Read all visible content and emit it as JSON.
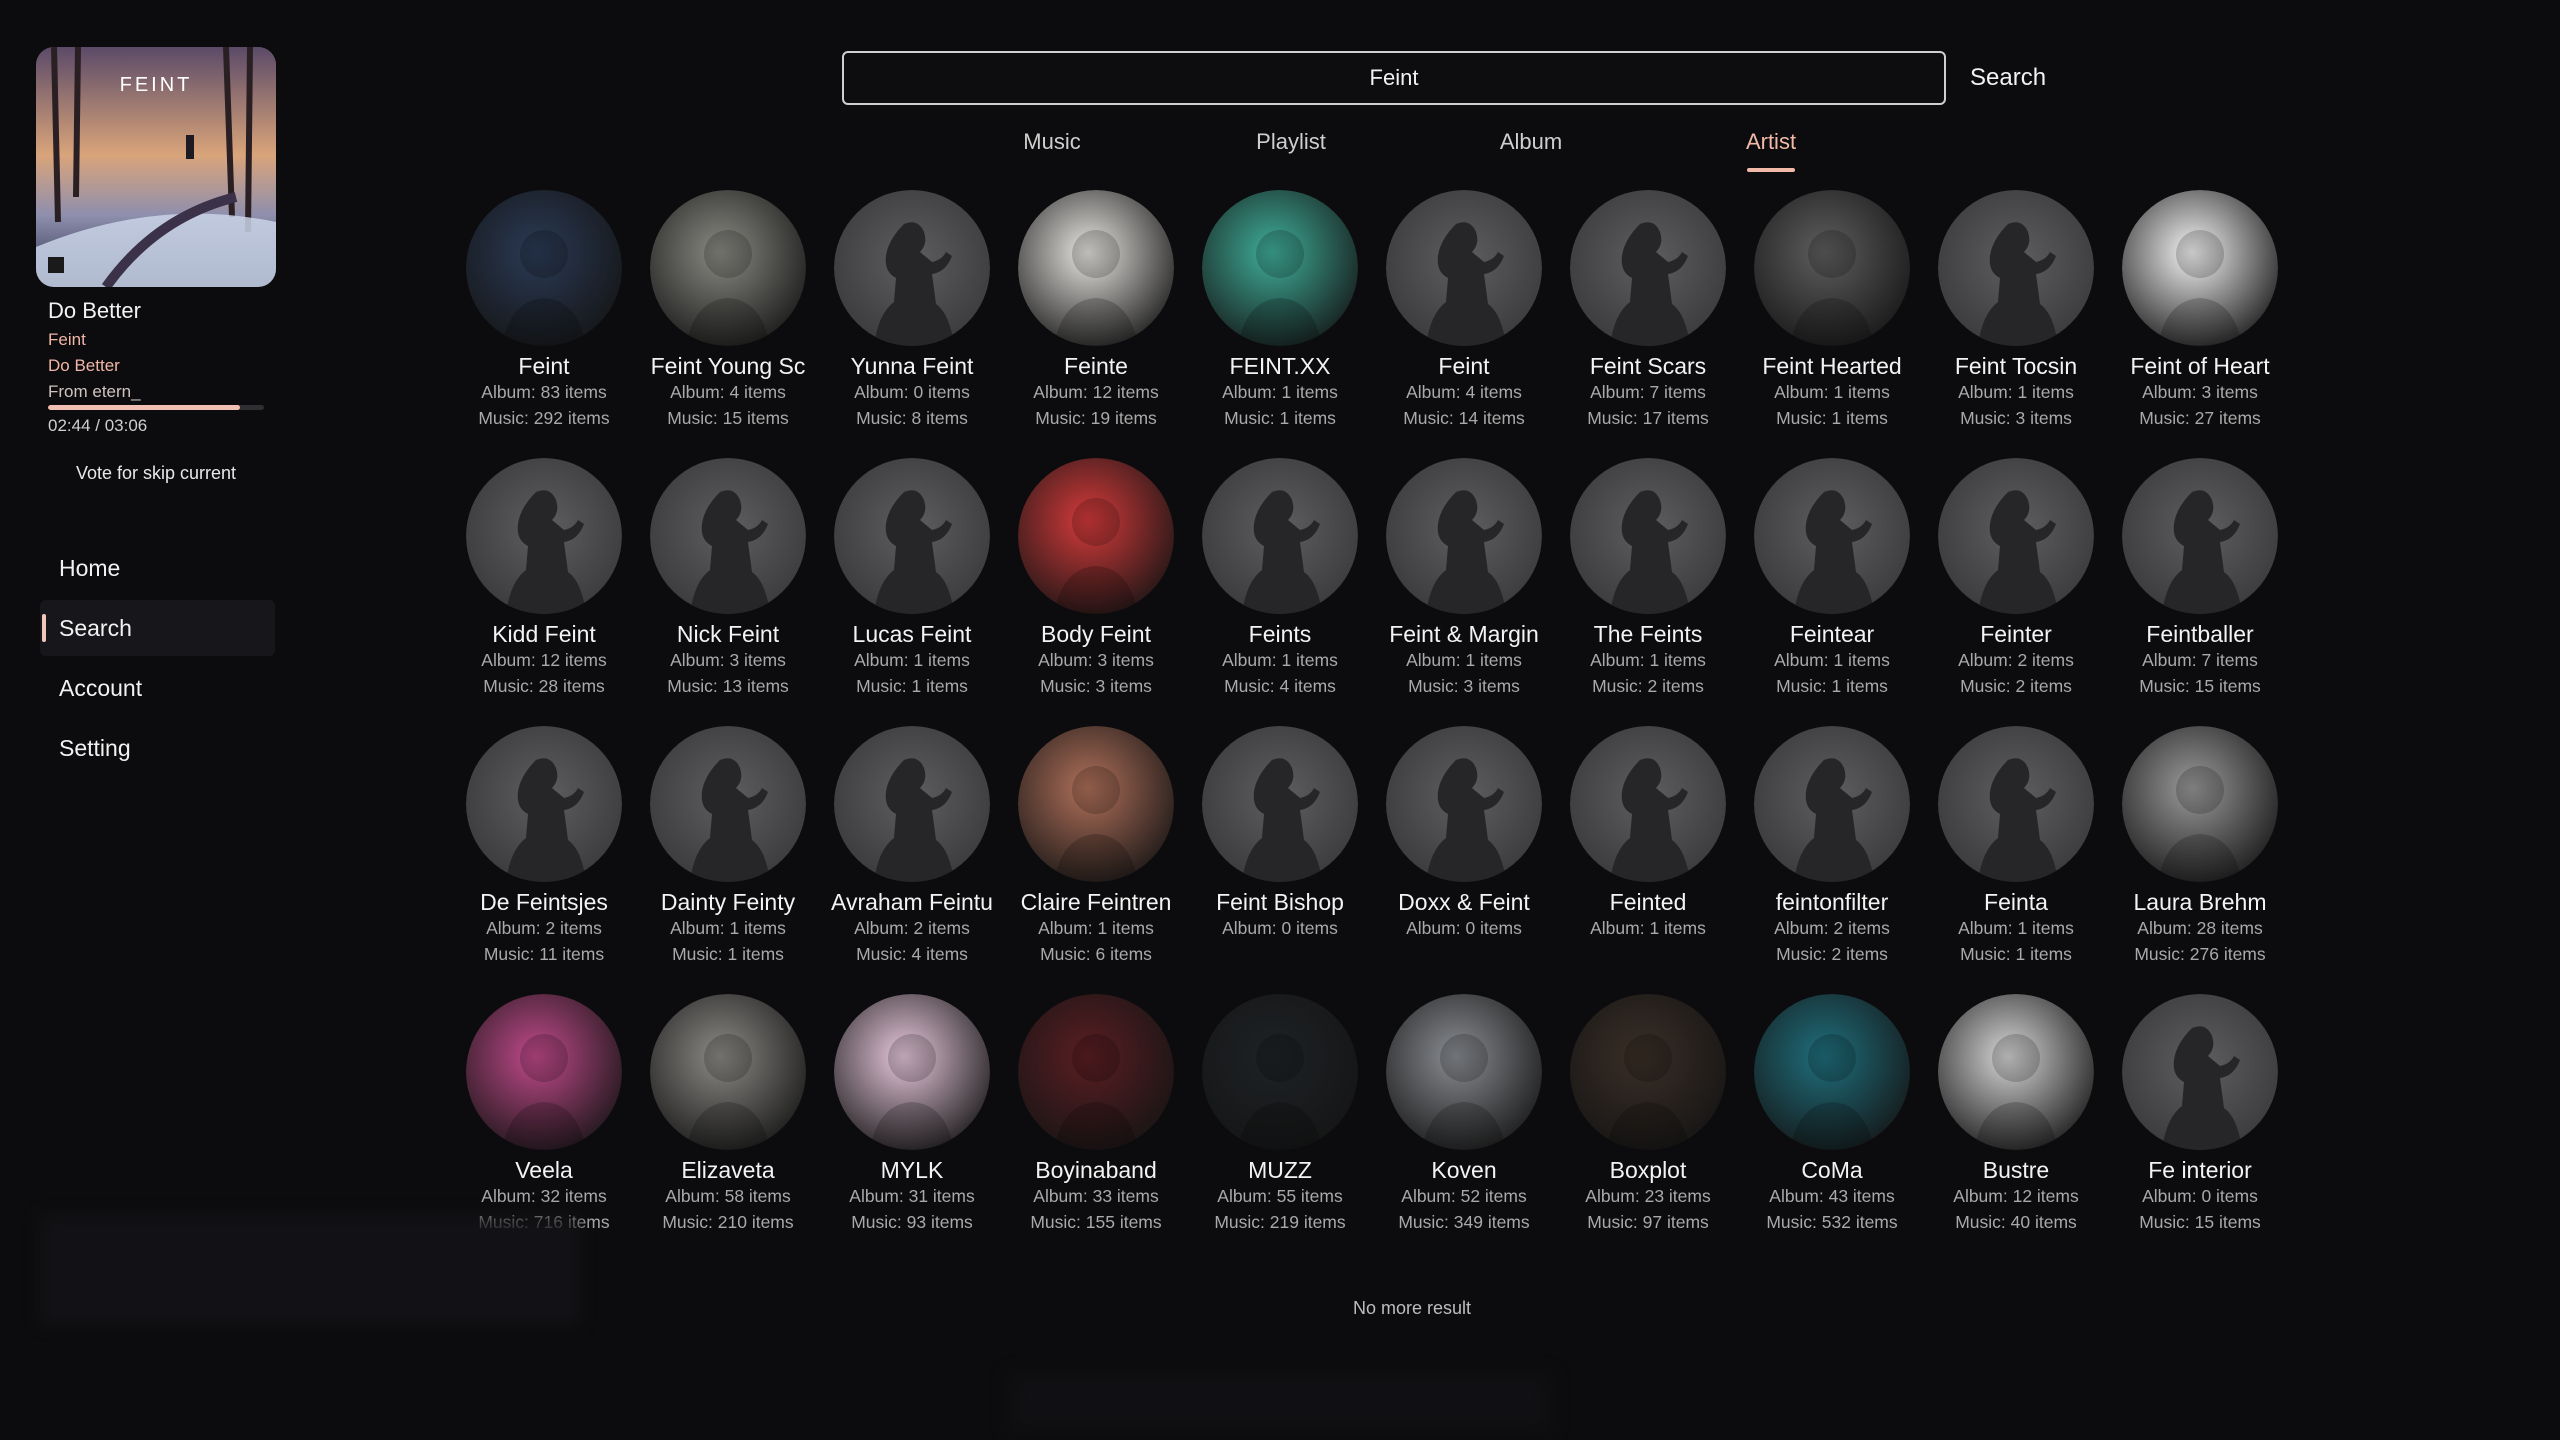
{
  "now_playing": {
    "title": "Do Better",
    "artist": "Feint",
    "album": "Do Better",
    "source": "From etern_",
    "time": "02:44 / 03:06",
    "progress": 0.89,
    "skip_label": "Vote for skip current",
    "cover_text": "FEINT"
  },
  "nav": {
    "items": [
      {
        "label": "Home"
      },
      {
        "label": "Search"
      },
      {
        "label": "Account"
      },
      {
        "label": "Setting"
      }
    ],
    "active": "Search"
  },
  "search": {
    "value": "Feint",
    "button_label": "Search"
  },
  "tabs": {
    "items": [
      {
        "label": "Music"
      },
      {
        "label": "Playlist"
      },
      {
        "label": "Album"
      },
      {
        "label": "Artist"
      }
    ],
    "active": "Artist"
  },
  "artists": [
    {
      "name": "Feint",
      "album": "Album: 83 items",
      "music": "Music: 292 items",
      "art": "#2a3a55"
    },
    {
      "name": "Feint Young Sc",
      "album": "Album: 4 items",
      "music": "Music: 15 items",
      "art": "#8a8a84"
    },
    {
      "name": "Yunna Feint",
      "album": "Album: 0 items",
      "music": "Music: 8 items",
      "art": "silhouette"
    },
    {
      "name": "Feinte",
      "album": "Album: 12 items",
      "music": "Music: 19 items",
      "art": "#e8e6e2"
    },
    {
      "name": "FEINT.XX",
      "album": "Album: 1 items",
      "music": "Music: 1 items",
      "art": "#3fae9a"
    },
    {
      "name": "Feint",
      "album": "Album: 4 items",
      "music": "Music: 14 items",
      "art": "silhouette"
    },
    {
      "name": "Feint Scars",
      "album": "Album: 7 items",
      "music": "Music: 17 items",
      "art": "silhouette"
    },
    {
      "name": "Feint Hearted",
      "album": "Album: 1 items",
      "music": "Music: 1 items",
      "art": "#5e5e5e"
    },
    {
      "name": "Feint Tocsin",
      "album": "Album: 1 items",
      "music": "Music: 3 items",
      "art": "silhouette"
    },
    {
      "name": "Feint of Heart",
      "album": "Album: 3 items",
      "music": "Music: 27 items",
      "art": "#f4f4f4"
    },
    {
      "name": "Kidd Feint",
      "album": "Album: 12 items",
      "music": "Music: 28 items",
      "art": "silhouette"
    },
    {
      "name": "Nick Feint",
      "album": "Album: 3 items",
      "music": "Music: 13 items",
      "art": "silhouette"
    },
    {
      "name": "Lucas Feint",
      "album": "Album: 1 items",
      "music": "Music: 1 items",
      "art": "silhouette"
    },
    {
      "name": "Body Feint",
      "album": "Album: 3 items",
      "music": "Music: 3 items",
      "art": "#d43a3a"
    },
    {
      "name": "Feints",
      "album": "Album: 1 items",
      "music": "Music: 4 items",
      "art": "silhouette"
    },
    {
      "name": "Feint & Margin",
      "album": "Album: 1 items",
      "music": "Music: 3 items",
      "art": "silhouette"
    },
    {
      "name": "The Feints",
      "album": "Album: 1 items",
      "music": "Music: 2 items",
      "art": "silhouette"
    },
    {
      "name": "Feintear",
      "album": "Album: 1 items",
      "music": "Music: 1 items",
      "art": "silhouette"
    },
    {
      "name": "Feinter",
      "album": "Album: 2 items",
      "music": "Music: 2 items",
      "art": "silhouette"
    },
    {
      "name": "Feintballer",
      "album": "Album: 7 items",
      "music": "Music: 15 items",
      "art": "silhouette"
    },
    {
      "name": "De Feintsjes",
      "album": "Album: 2 items",
      "music": "Music: 11 items",
      "art": "silhouette"
    },
    {
      "name": "Dainty Feinty",
      "album": "Album: 1 items",
      "music": "Music: 1 items",
      "art": "silhouette"
    },
    {
      "name": "Avraham Feintu",
      "album": "Album: 2 items",
      "music": "Music: 4 items",
      "art": "silhouette"
    },
    {
      "name": "Claire Feintren",
      "album": "Album: 1 items",
      "music": "Music: 6 items",
      "art": "#b0705a"
    },
    {
      "name": "Feint Bishop",
      "album": "Album: 0 items",
      "music": "",
      "art": "silhouette"
    },
    {
      "name": "Doxx & Feint",
      "album": "Album: 0 items",
      "music": "",
      "art": "silhouette"
    },
    {
      "name": "Feinted",
      "album": "Album: 1 items",
      "music": "",
      "art": "silhouette"
    },
    {
      "name": "feintonfilter",
      "album": "Album: 2 items",
      "music": "Music: 2 items",
      "art": "silhouette"
    },
    {
      "name": "Feinta",
      "album": "Album: 1 items",
      "music": "Music: 1 items",
      "art": "silhouette"
    },
    {
      "name": "Laura Brehm",
      "album": "Album: 28 items",
      "music": "Music: 276 items",
      "art": "#9a9a9a"
    },
    {
      "name": "Veela",
      "album": "Album: 32 items",
      "music": "Music: 716 items",
      "art": "#c04a8a"
    },
    {
      "name": "Elizaveta",
      "album": "Album: 58 items",
      "music": "Music: 210 items",
      "art": "#8c8a86"
    },
    {
      "name": "MYLK",
      "album": "Album: 31 items",
      "music": "Music: 93 items",
      "art": "#e7c8dc"
    },
    {
      "name": "Boyinaband",
      "album": "Album: 33 items",
      "music": "Music: 155 items",
      "art": "#5a1e22"
    },
    {
      "name": "MUZZ",
      "album": "Album: 55 items",
      "music": "Music: 219 items",
      "art": "#1e2226"
    },
    {
      "name": "Koven",
      "album": "Album: 52 items",
      "music": "Music: 349 items",
      "art": "#8a8d92"
    },
    {
      "name": "Boxplot",
      "album": "Album: 23 items",
      "music": "Music: 97 items",
      "art": "#3a2e26"
    },
    {
      "name": "CoMa",
      "album": "Album: 43 items",
      "music": "Music: 532 items",
      "art": "#1f6f7d"
    },
    {
      "name": "Bustre",
      "album": "Album: 12 items",
      "music": "Music: 40 items",
      "art": "#d6d6d6"
    },
    {
      "name": "Fe interior",
      "album": "Album: 0 items",
      "music": "Music: 15 items",
      "art": "silhouette"
    }
  ],
  "footer": {
    "no_more": "No more result"
  },
  "colors": {
    "accent": "#f1b9a8",
    "background": "#0c0c0e"
  }
}
